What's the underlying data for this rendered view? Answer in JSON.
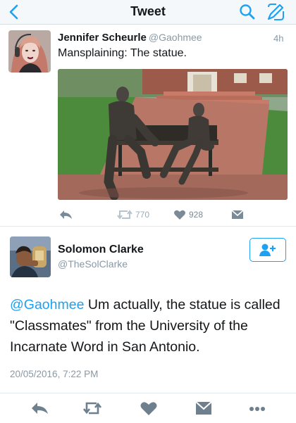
{
  "navbar": {
    "title": "Tweet"
  },
  "tweet1": {
    "name": "Jennifer Scheurle",
    "handle": "@Gaohmee",
    "time": "4h",
    "text": "Mansplaining: The statue.",
    "retweet_count": "770",
    "like_count": "928"
  },
  "tweet2": {
    "name": "Solomon Clarke",
    "handle": "@TheSolClarke",
    "mention": "@Gaohmee",
    "body": " Um actually, the statue is called \"Classmates\" from the University of the Incarnate Word in San Antonio.",
    "date": "20/05/2016, 7:22 PM"
  },
  "colors": {
    "accent": "#1da1f2",
    "muted": "#8899a6",
    "icon_gray": "#6e7f8d",
    "divider": "#e1e8ed"
  },
  "icons": [
    "back-icon",
    "search-icon",
    "compose-icon",
    "reply-icon",
    "retweet-icon",
    "like-icon",
    "message-icon",
    "follow-icon",
    "more-icon"
  ]
}
